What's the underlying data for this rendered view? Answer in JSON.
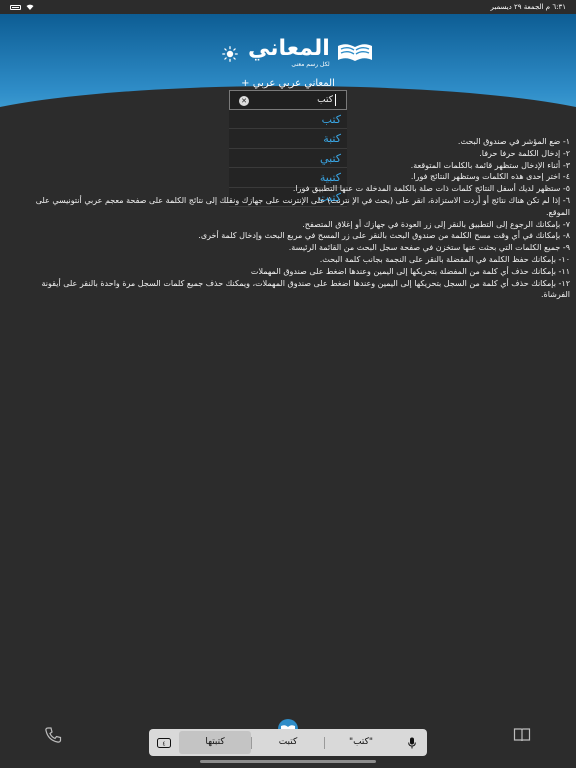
{
  "status_bar": {
    "time_date": "٦:٣١ م الجمعة ٢٩ ديسمبر",
    "battery_icon": "battery-icon",
    "wifi_icon": "wifi-icon"
  },
  "header": {
    "logo_title": "المعاني",
    "logo_tagline": "لكل رسم معنى",
    "dictionary_selector": "المعاني عربي عربي +",
    "theme_icon": "sun-icon",
    "brand_color": "#2f8dc8"
  },
  "search": {
    "value": "كتب"
  },
  "suggestions": [
    "كتب",
    "كتبة",
    "كتبي",
    "كتبية",
    "كتبت"
  ],
  "instructions": [
    "١- ضع المؤشر في صندوق البحث.",
    "٢- إدخال الكلمة حرفا حرفا.",
    "٣- أثناء الإدخال ستظهر قائمة بالكلمات المتوقعة.",
    "٤- اختر إحدى هذه الكلمات وستظهر النتائج فورا.",
    "٥- ستظهر لديك أسفل النتائج كلمات ذات صلة بالكلمة المدخلة ت عنها التطبيق فورا.",
    "٦- إذا لم تكن هناك نتائج أو أردت الاستزادة، انقر على (بحث في الإ نترنت) على الإنترنت على جهازك ونقلك إلى نتائج الكلمة على صفحة معجم عربي أنتونيسي على الموقع.",
    "٧- بإمكانك الرجوع إلى التطبيق بالنقر إلى زر العودة في جهازك أو إغلاق المتصفح.",
    "٨- بإمكانك في أي وقت مسح الكلمة من صندوق البحث بالنقر على زر المسح في مربع البحث وإدخال كلمة أخرى.",
    "٩- جميع الكلمات التي بحثت عنها ستخزن في صفحة سجل البحث من القائمة الرئيسة.",
    "١٠- بإمكانك حفظ الكلمة في المفضلة بالنقر على النجمة بجانب كلمة البحث.",
    "١١- بإمكانك حذف أي كلمة من المفضلة بتحريكها إلى اليمين وعندها اضغط على صندوق المهملات",
    "١٢- بإمكانك حذف أي كلمة من السجل بتحريكها إلى اليمين وعندها اضغط على صندوق المهملات، ويمكنك حذف جميع كلمات السجل مرة واحدة بالنقر على أيقونة الفرشاة."
  ],
  "tabbar": {
    "left_icon": "phone-icon",
    "center_icon": "logo-book-icon",
    "right_icon": "book-icon"
  },
  "keyboard_bar": {
    "suggestions": [
      "كتبتها",
      "كتبت",
      "\"كتب\""
    ],
    "left_icon": "keyboard-icon",
    "right_icon": "microphone-icon"
  }
}
